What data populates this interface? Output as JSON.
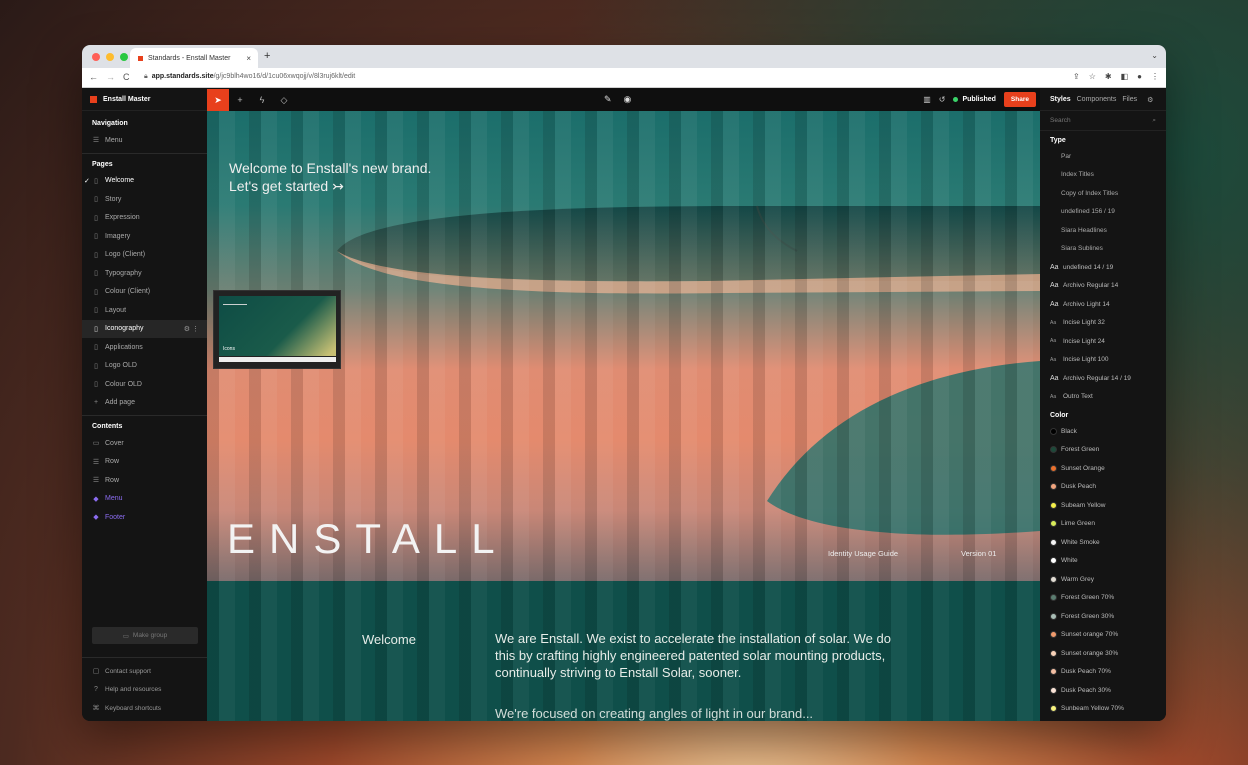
{
  "browser": {
    "tab_title": "Standards - Enstall Master",
    "tab_close": "×",
    "new_tab": "+",
    "tab_menu": "⌄",
    "url_host": "app.standards.site",
    "url_path": "/g/jc9blh4wo16/d/1cu06xwqojj/v/8l3ruj6klt/edit",
    "nav_back": "←",
    "nav_forward": "→",
    "nav_reload": "C"
  },
  "sidebar": {
    "brand": "Enstall Master",
    "navigation_heading": "Navigation",
    "menu_label": "Menu",
    "pages_heading": "Pages",
    "pages": [
      "Welcome",
      "Story",
      "Expression",
      "Imagery",
      "Logo (Client)",
      "Typography",
      "Colour (Client)",
      "Layout",
      "Iconography",
      "Applications",
      "Logo OLD",
      "Colour OLD"
    ],
    "add_page": "Add page",
    "contents_heading": "Contents",
    "contents": [
      "Cover",
      "Row",
      "Row",
      "Menu",
      "Footer"
    ],
    "make_group": "Make group",
    "bottom": [
      "Contact support",
      "Help and resources",
      "Keyboard shortcuts"
    ]
  },
  "toolbar": {
    "status": "Published",
    "share_label": "Share"
  },
  "canvas": {
    "intro_line1": "Welcome to Enstall's new brand.",
    "intro_line2": "Let's get started ↣",
    "logo_text": "ENSTALL",
    "meta_left": "Identity Usage Guide",
    "meta_right": "Version 01",
    "section_heading": "Welcome",
    "section_body": "We are Enstall. We exist to accelerate the installation of solar. We do this by crafting highly engineered patented solar mounting products, continually striving to Enstall Solar, sooner.",
    "section_body_2": "We're focused on creating angles of light in our brand...",
    "thumbnail_label": "Icons"
  },
  "styles_panel": {
    "tabs": [
      "Styles",
      "Components",
      "Files"
    ],
    "search_placeholder": "Search",
    "type_heading": "Type",
    "type_items_plain": [
      "Par",
      "Index Titles",
      "Copy of Index Titles",
      "undefined 156 / 19",
      "Siara Headlines",
      "Siara Sublines"
    ],
    "type_items_aa": [
      {
        "label": "undefined 14 / 19",
        "glyph": "Aa",
        "small": false
      },
      {
        "label": "Archivo Regular 14",
        "glyph": "Aa",
        "small": false
      },
      {
        "label": "Archivo Light 14",
        "glyph": "Aa",
        "small": false
      },
      {
        "label": "Incise Light 32",
        "glyph": "Aa",
        "small": true
      },
      {
        "label": "Incise Light 24",
        "glyph": "Aa",
        "small": true
      },
      {
        "label": "Incise Light 100",
        "glyph": "Aa",
        "small": true
      },
      {
        "label": "Archivo Regular 14 / 19",
        "glyph": "Aa",
        "small": false
      },
      {
        "label": "Outro Text",
        "glyph": "Aa",
        "small": true
      }
    ],
    "color_heading": "Color",
    "colors": [
      {
        "label": "Black",
        "hex": "#000000"
      },
      {
        "label": "Forest Green",
        "hex": "#1d4a3a"
      },
      {
        "label": "Sunset Orange",
        "hex": "#e9702d"
      },
      {
        "label": "Dusk Peach",
        "hex": "#f0a47e"
      },
      {
        "label": "Subeam Yellow",
        "hex": "#f4ef4a"
      },
      {
        "label": "Lime Green",
        "hex": "#d8ec5a"
      },
      {
        "label": "White Smoke",
        "hex": "#f4f4f4"
      },
      {
        "label": "White",
        "hex": "#ffffff"
      },
      {
        "label": "Warm Grey",
        "hex": "#e2ddd4"
      },
      {
        "label": "Forest Green 70%",
        "hex": "#5b7d70"
      },
      {
        "label": "Forest Green 30%",
        "hex": "#a9bdb5"
      },
      {
        "label": "Sunset orange 70%",
        "hex": "#ef9a6c"
      },
      {
        "label": "Sunset orange 30%",
        "hex": "#f8d2b9"
      },
      {
        "label": "Dusk Peach 70%",
        "hex": "#f4bfa3"
      },
      {
        "label": "Dusk Peach 30%",
        "hex": "#fae3d6"
      },
      {
        "label": "Sunbeam Yellow 70%",
        "hex": "#f7f37f"
      }
    ]
  }
}
